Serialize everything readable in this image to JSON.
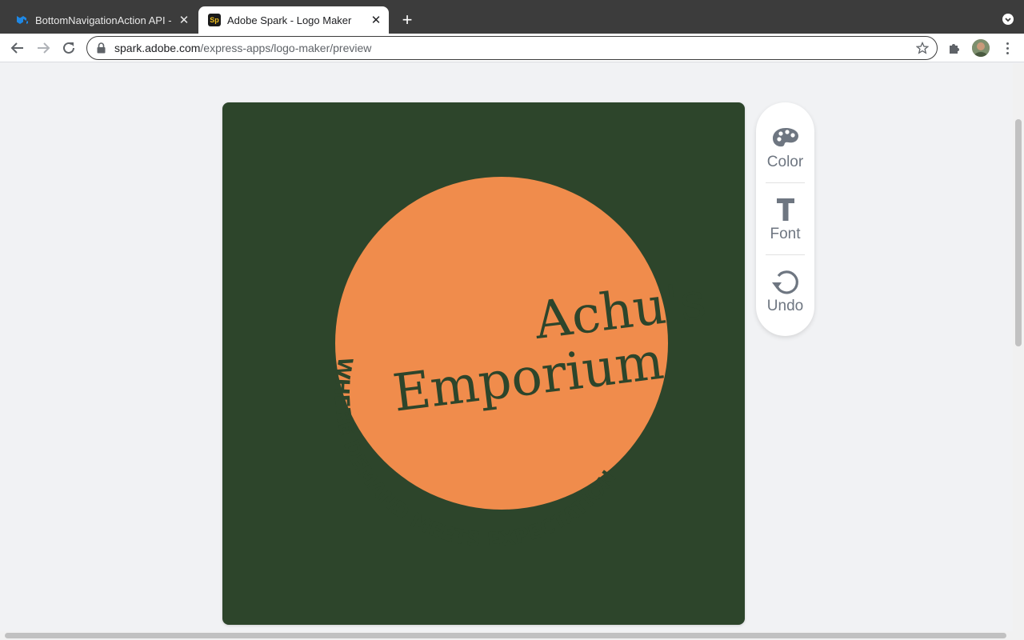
{
  "browser": {
    "tabs": [
      {
        "title": "BottomNavigationAction API - |",
        "favicon": "mui-logo-icon",
        "active": false
      },
      {
        "title": "Adobe Spark - Logo Maker",
        "favicon": "adobe-spark-icon",
        "favicon_text": "Sp",
        "active": true
      }
    ],
    "close_glyph": "✕",
    "new_tab_glyph": "+",
    "url_host": "spark.adobe.com",
    "url_path": "/express-apps/logo-maker/preview"
  },
  "logo": {
    "line1": "Achu's",
    "line2": "Emporium",
    "tagline": "WHERE DEMAND MEETS EXPECTATION",
    "colors": {
      "background": "#2d452b",
      "circle": "#f08c4c",
      "text": "#2d452b"
    }
  },
  "toolpanel": {
    "color_label": "Color",
    "font_label": "Font",
    "undo_label": "Undo"
  }
}
